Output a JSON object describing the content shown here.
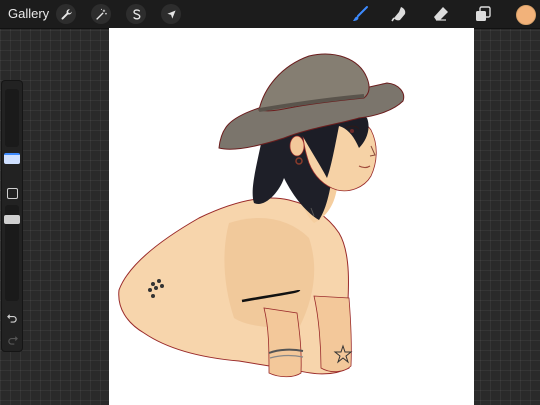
{
  "topbar": {
    "gallery_label": "Gallery",
    "actions_icon": "wrench-icon",
    "adjustments_icon": "magic-wand-icon",
    "selection_icon": "selection-s-icon",
    "transform_icon": "arrow-cursor-icon"
  },
  "tools": {
    "brush_icon": "brush-icon",
    "smudge_icon": "smudge-icon",
    "eraser_icon": "eraser-icon",
    "layers_icon": "layers-icon",
    "active_tool": "brush",
    "active_color": "#f2b27a",
    "accent": "#3d8bff"
  },
  "sidebar": {
    "undo_icon": "undo-icon",
    "redo_icon": "redo-icon",
    "modify_icon": "square-icon"
  },
  "canvas": {
    "subject": "drawing"
  }
}
